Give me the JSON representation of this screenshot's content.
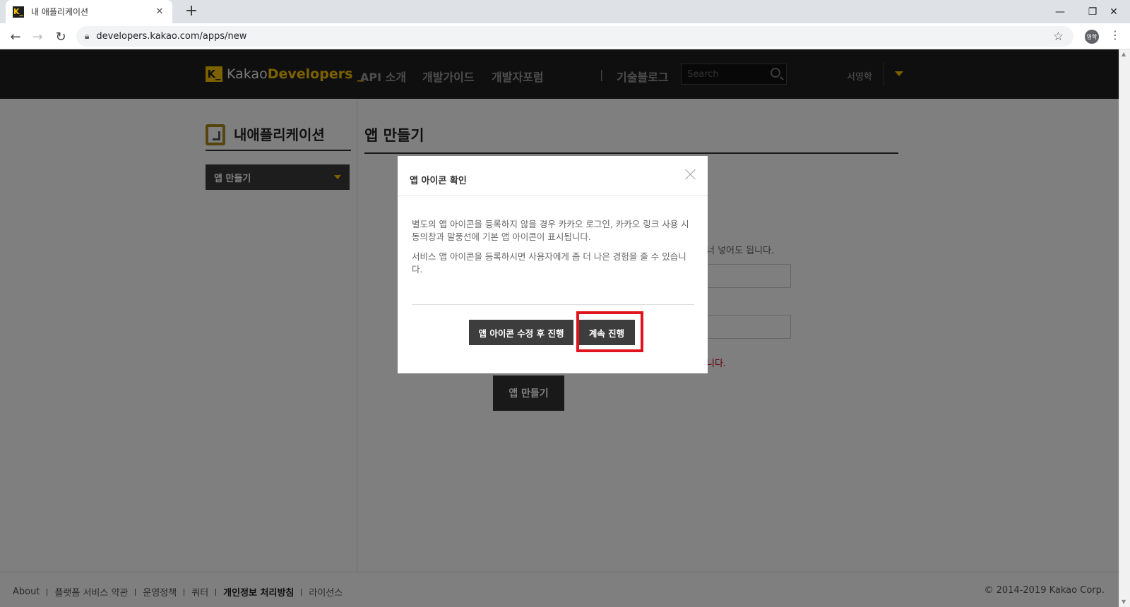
{
  "browser": {
    "tab_title": "내 애플리케이션",
    "favicon_text": "K_",
    "new_tab_symbol": "+",
    "tab_close_symbol": "✕",
    "url": "developers.kakao.com/apps/new",
    "profile_text": "영학",
    "win_min": "—",
    "win_restore": "❐",
    "win_close": "✕"
  },
  "header": {
    "logo_mark": "K_",
    "logo_text_1": "Kakao",
    "logo_text_2": "Developers _",
    "nav": [
      "API 소개",
      "개발가이드",
      "개발자포럼"
    ],
    "nav_separator": "|",
    "blog": "기술블로그",
    "search_placeholder": "Search",
    "user_name": "서영학"
  },
  "sidebar": {
    "title": "내애플리케이션",
    "select_value": "앱 만들기"
  },
  "main": {
    "title": "앱 만들기",
    "hint_text": "너 넣어도 됩니다.",
    "error_text": "니다.",
    "create_button": "앱 만들기"
  },
  "footer": {
    "links": [
      "About",
      "플랫폼 서비스 약관",
      "운영정책",
      "쿼터",
      "개인정보 처리방침",
      "라이선스"
    ],
    "copyright": "© 2014-2019 Kakao Corp."
  },
  "modal": {
    "title": "앱 아이콘 확인",
    "paragraph_1": "별도의 앱 아이콘을 등록하지 않을 경우 카카오 로그인, 카카오 링크 사용 시 동의창과 말풍선에 기본 앱 아이콘이 표시됩니다.",
    "paragraph_2": "서비스 앱 아이콘을 등록하시면 사용자에게 좀 더 나은 경험을 줄 수 있습니다.",
    "edit_button": "앱 아이콘 수정 후 진행",
    "continue_button": "계속 진행"
  },
  "colors": {
    "brand_yellow": "#f7c300",
    "header_bg": "#1e1e1e",
    "highlight_red": "#e0141e",
    "error_red": "#d0021b"
  }
}
